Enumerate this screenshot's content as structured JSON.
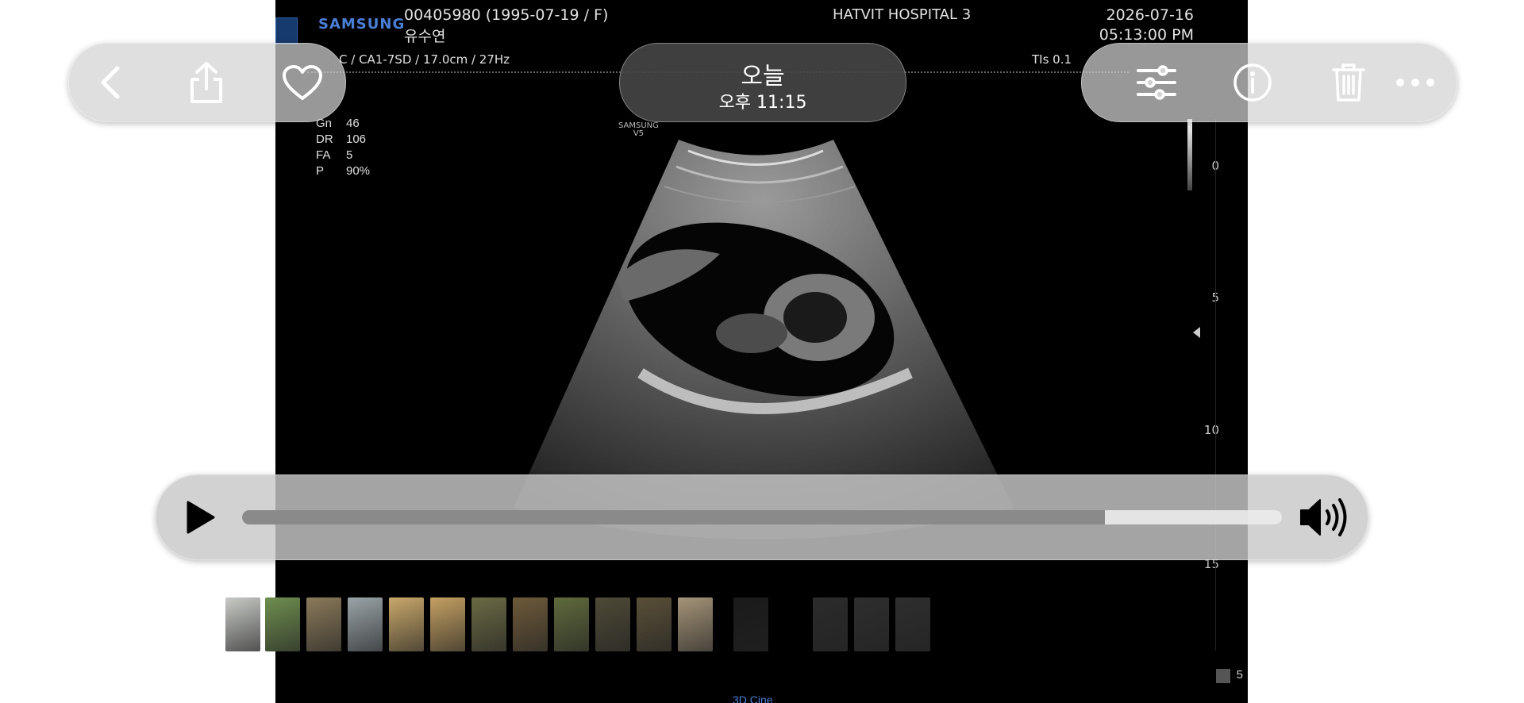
{
  "ultrasound": {
    "brand": "SAMSUNG",
    "patient_info": "00405980 (1995-07-19 / F)",
    "patient_name": "유수연",
    "hospital": "HATVIT HOSPITAL 3",
    "exam_date": "2026-07-16",
    "exam_time": "05:13:00 PM",
    "probe_info": "C / CA1-7SD / 17.0cm / 27Hz",
    "tis": "TIs  0.1",
    "params": [
      {
        "label": "Gn",
        "value": "46"
      },
      {
        "label": "DR",
        "value": "106"
      },
      {
        "label": "FA",
        "value": "5"
      },
      {
        "label": "P",
        "value": "90%"
      }
    ],
    "mini_brand": "SAMSUNG",
    "mini_brand_sub": "V5",
    "depth_scale": [
      "0",
      "5",
      "10",
      "15"
    ],
    "bottom_label": "3D Cine",
    "side_number": "5"
  },
  "header": {
    "title": "오늘",
    "subtitle": "오후 11:15"
  },
  "icons": {
    "back": "chevron-left-icon",
    "share": "share-icon",
    "favorite": "heart-icon",
    "adjust": "sliders-icon",
    "info": "info-icon",
    "delete": "trash-icon",
    "more": "more-icon",
    "play": "play-icon",
    "volume": "volume-icon"
  },
  "player": {
    "progress": 0.83
  },
  "thumbnails": [
    {
      "color": "#c8cbc6"
    },
    {
      "color": "#6f8f4f"
    },
    {
      "color": "#8b7a5a"
    },
    {
      "color": "#9aa4a8"
    },
    {
      "color": "#c9a86a"
    },
    {
      "color": "#c4a062"
    },
    {
      "color": "#6b6a44"
    },
    {
      "color": "#6e5a3a"
    },
    {
      "color": "#5f6a3c"
    },
    {
      "color": "#4e4a36"
    },
    {
      "color": "#5a5038"
    },
    {
      "color": "#a59478"
    },
    {
      "color": "#1a1a1a"
    },
    {
      "color": "#000000"
    },
    {
      "color": "#2b2b2b"
    },
    {
      "color": "#2e2e2e"
    },
    {
      "color": "#2e2e2e"
    }
  ],
  "colors": {
    "accent": "#4a7fd6",
    "pill": "#d2d2d2",
    "video_bg": "#000000"
  }
}
